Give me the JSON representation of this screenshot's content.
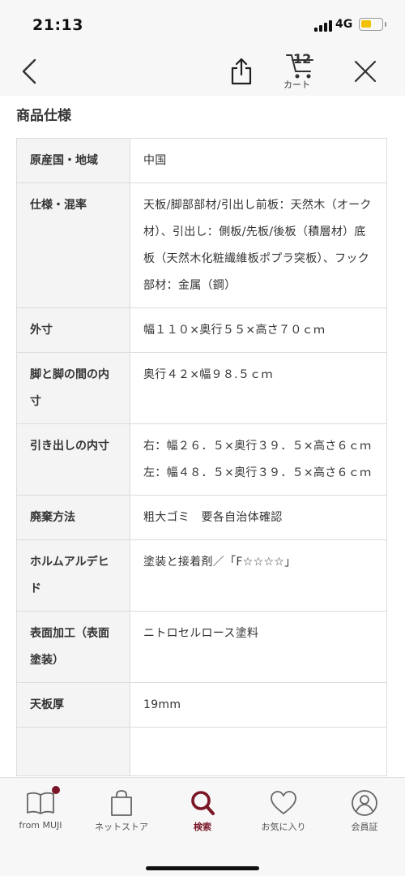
{
  "status_bar": {
    "time": "21:13",
    "network": "4G",
    "battery_color": "#f2c200"
  },
  "nav": {
    "back_icon": "chevron-left-icon",
    "share_icon": "share-icon",
    "cart_count": "12",
    "cart_label": "カート",
    "close_icon": "close-icon"
  },
  "section": {
    "title": "商品仕様"
  },
  "specs": [
    {
      "label": "原産国・地域",
      "value": "中国"
    },
    {
      "label": "仕様・混率",
      "value": "天板/脚部部材/引出し前板：天然木（オーク材）、引出し：側板/先板/後板（積層材）底板（天然木化粧繊維板ポプラ突板）、フック部材：金属（鋼）"
    },
    {
      "label": "外寸",
      "value": "幅１１０×奥行５５×高さ７０ｃｍ"
    },
    {
      "label": "脚と脚の間の内寸",
      "value": "奥行４２×幅９８.５ｃｍ"
    },
    {
      "label": "引き出しの内寸",
      "value": "右：幅２６．５×奥行３９．５×高さ６ｃｍ　左：幅４８．５×奥行３９．５×高さ６ｃｍ"
    },
    {
      "label": "廃棄方法",
      "value": "粗大ゴミ　要各自治体確認"
    },
    {
      "label": "ホルムアルデヒド",
      "value": "塗装と接着剤／「F☆☆☆☆」"
    },
    {
      "label": "表面加工（表面塗装）",
      "value": "ニトロセルロース塗料"
    },
    {
      "label": "天板厚",
      "value": "19mm"
    },
    {
      "label": "",
      "value": ""
    }
  ],
  "tabs": [
    {
      "label": "from MUJI",
      "icon": "book-icon",
      "active": false
    },
    {
      "label": "ネットストア",
      "icon": "shopping-bag-icon",
      "active": false
    },
    {
      "label": "検索",
      "icon": "search-icon",
      "active": true
    },
    {
      "label": "お気に入り",
      "icon": "heart-icon",
      "active": false
    },
    {
      "label": "会員証",
      "icon": "user-icon",
      "active": false
    }
  ],
  "colors": {
    "accent": "#7a1526",
    "label_bg": "#f4f4f4",
    "border": "#dcdcdc"
  }
}
